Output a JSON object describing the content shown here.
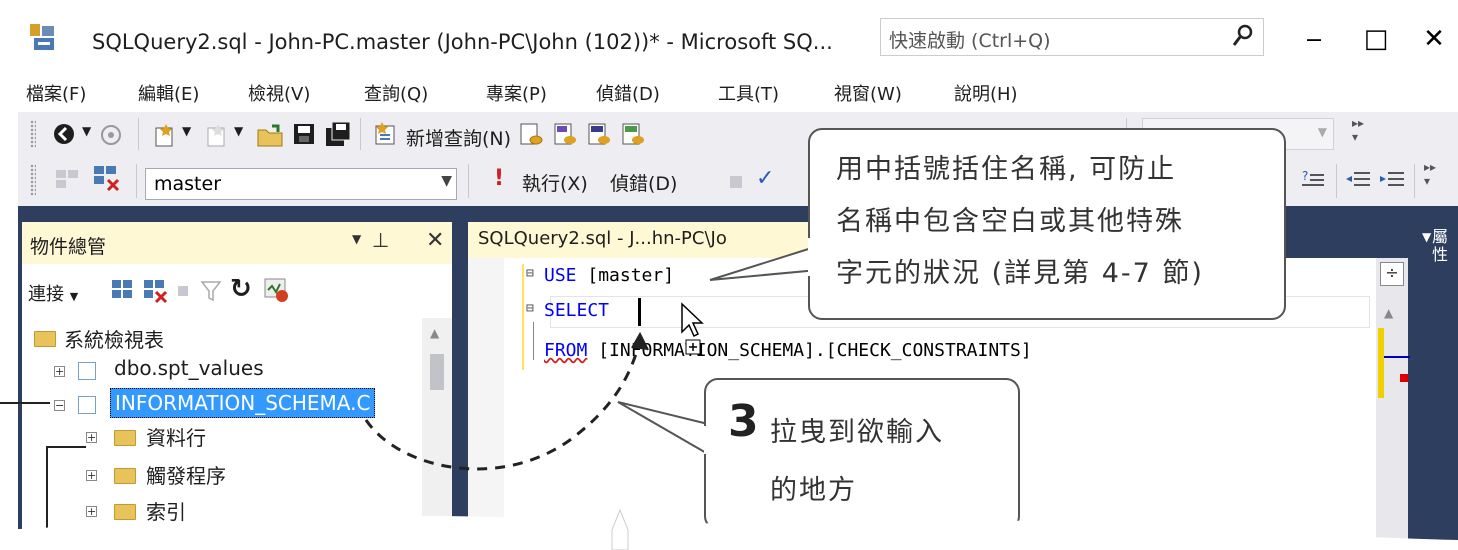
{
  "window": {
    "title": "SQLQuery2.sql - John-PC.master (John-PC\\John (102))* - Microsoft SQ...",
    "quick_launch_placeholder": "快速啟動 (Ctrl+Q)",
    "minimize": "‒",
    "maximize": "□",
    "close": "✕"
  },
  "menu": [
    "檔案(F)",
    "編輯(E)",
    "檢視(V)",
    "查詢(Q)",
    "專案(P)",
    "偵錯(D)",
    "工具(T)",
    "視窗(W)",
    "說明(H)"
  ],
  "toolbar": {
    "new_query": "新增查詢(N)",
    "database": "master",
    "execute": "執行(X)",
    "debug": "偵錯(D)"
  },
  "object_explorer": {
    "title": "物件總管",
    "connect": "連接",
    "pin": "ㅍ",
    "close": "✕",
    "tree": [
      {
        "label": "系統檢視表",
        "type": "folder",
        "expander": ""
      },
      {
        "label": "dbo.spt_values",
        "type": "table",
        "expander": "+"
      },
      {
        "label": "INFORMATION_SCHEMA.C",
        "type": "table",
        "expander": "−",
        "selected": true
      },
      {
        "label": "資料行",
        "type": "folder",
        "expander": "+"
      },
      {
        "label": "觸發程序",
        "type": "folder",
        "expander": "+"
      },
      {
        "label": "索引",
        "type": "folder",
        "expander": "+"
      }
    ]
  },
  "editor": {
    "tab_label": "SQLQuery2.sql - J...hn-PC\\Jo",
    "lines": [
      {
        "keyword": "USE",
        "text": " [master]"
      },
      {
        "keyword": "SELECT",
        "text": " "
      },
      {
        "keyword": "FROM",
        "text": " [INFORMATION_SCHEMA].[CHECK_CONSTRAINTS]"
      }
    ]
  },
  "properties_label": "屬性",
  "callouts": {
    "brackets": [
      "用中括號括住名稱, 可防止",
      "名稱中包含空白或其他特殊",
      "字元的狀況 (詳見第 4-7 節)"
    ],
    "step_number": "3",
    "step_text": [
      "拉曳到欲輸入",
      "的地方"
    ]
  },
  "colors": {
    "accent_blue": "#2d3e5f",
    "keyword": "#0000ff",
    "selection": "#3399ff",
    "panel_header": "#fff8d4"
  }
}
